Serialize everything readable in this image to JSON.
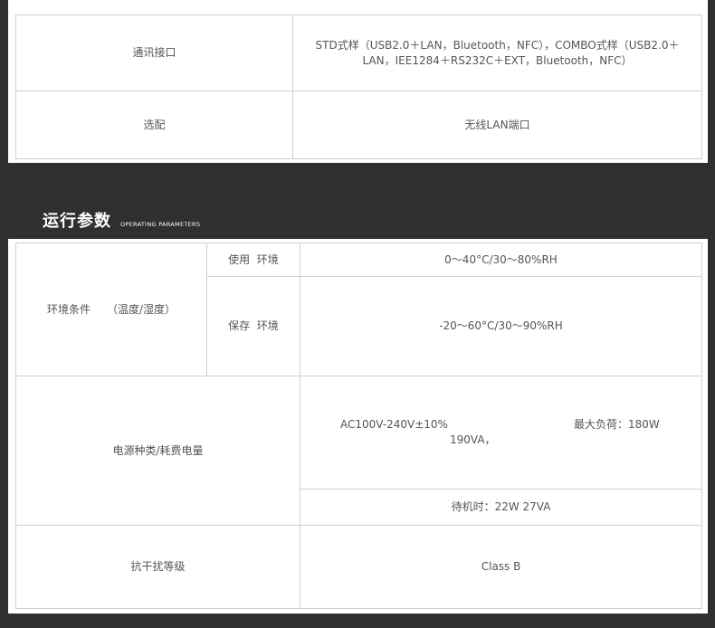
{
  "spec_top": {
    "rows": [
      {
        "label": "通讯接口",
        "value": "STD式样（USB2.0＋LAN，Bluetooth，NFC），COMBO式样（USB2.0＋LAN，IEE1284＋RS232C＋EXT，Bluetooth，NFC）"
      },
      {
        "label": "选配",
        "value": "无线LAN端口"
      }
    ]
  },
  "section": {
    "title": "运行参数",
    "subtitle": "OPERATING PARAMETERS"
  },
  "env": {
    "label": "环境条件　　（温度/湿度）",
    "usage_label": "使用  环境",
    "usage_value": "0～40°C/30～80%RH",
    "storage_label": "保存  环境",
    "storage_value": "-20～60°C/30～90%RH"
  },
  "power": {
    "label": "电源种类/耗费电量",
    "line_a": "AC100V-240V±10%",
    "line_b": "最大负荷：180W",
    "line_c": "190VA，",
    "standby": "待机时：22W 27VA"
  },
  "emi": {
    "label": "抗干扰等级",
    "value": "Class B"
  }
}
